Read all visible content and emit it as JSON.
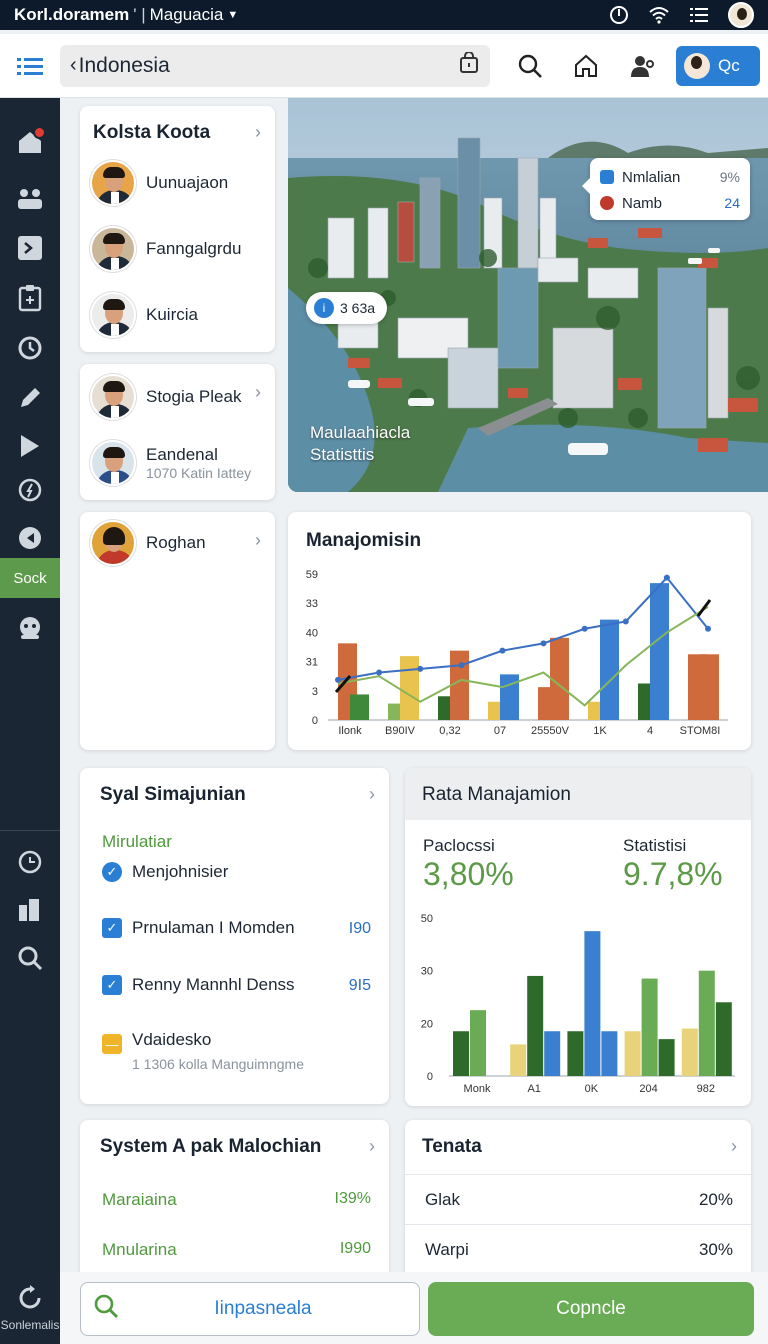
{
  "status": {
    "app_name": "Korl.doramem",
    "separator": "' |",
    "location": "Maguacia"
  },
  "toolbar": {
    "search_value": "Indonesia",
    "profile_label": "Qc"
  },
  "sidebar": {
    "active_label": "Sock",
    "bottom_label": "Sonlemalis"
  },
  "people_card": {
    "title": "Kolsta Koota",
    "people": [
      {
        "name": "Uunuajaon"
      },
      {
        "name": "Fanngalgrdu"
      },
      {
        "name": "Kuircia"
      }
    ]
  },
  "people_card2": {
    "people": [
      {
        "name": "Stogia Pleak"
      },
      {
        "name": "Eandenal",
        "sub": "1070 Katin Iattey"
      }
    ]
  },
  "people_card3": {
    "people": [
      {
        "name": "Roghan"
      }
    ]
  },
  "photo": {
    "caption_line1": "Maulaahiacla",
    "caption_line2": "Statisttis",
    "pill_icon": "i",
    "pill_text": "3 63a",
    "legend": [
      {
        "label": "Nmlalian",
        "value": "9%",
        "color": "#2a7fd4"
      },
      {
        "label": "Namb",
        "value": "24",
        "color": "#c0392b"
      }
    ]
  },
  "chart1": {
    "title": "Manajomisin"
  },
  "chart2": {
    "title": "Rata Manajamion",
    "stat1_label": "Paclocssi",
    "stat1_value": "3,80%",
    "stat2_label": "Statistisi",
    "stat2_value": "9.7,8%"
  },
  "chart_data": [
    {
      "type": "bar",
      "categories": [
        "Ilonk",
        "B90IV",
        "0,32",
        "07",
        "25550V",
        "1K",
        "4",
        "STOM8I"
      ],
      "y_ticks": [
        "0",
        "3",
        "31",
        "40",
        "33",
        "59"
      ],
      "series": [
        {
          "values": [
            28,
            12,
            16,
            10,
            18,
            6,
            14,
            14,
            16,
            16
          ]
        },
        {
          "values": [
            42,
            0,
            26,
            36,
            36,
            38,
            32,
            58,
            0,
            0
          ]
        }
      ],
      "bars": [
        {
          "x": 0,
          "value": 42,
          "color": "#cf6a3c"
        },
        {
          "x": 0.12,
          "value": 14,
          "color": "#3f8a3a"
        },
        {
          "x": 1,
          "value": 9,
          "color": "#86b55a"
        },
        {
          "x": 1.12,
          "value": 35,
          "color": "#e8c34d"
        },
        {
          "x": 2,
          "value": 13,
          "color": "#2e6b2b"
        },
        {
          "x": 2.12,
          "value": 38,
          "color": "#cf6a3c"
        },
        {
          "x": 3,
          "value": 10,
          "color": "#e8c34d"
        },
        {
          "x": 3.12,
          "value": 25,
          "color": "#3b7fd0"
        },
        {
          "x": 4,
          "value": 18,
          "color": "#cf6a3c"
        },
        {
          "x": 4.12,
          "value": 45,
          "color": "#cf6a3c"
        },
        {
          "x": 5,
          "value": 10,
          "color": "#e8c34d"
        },
        {
          "x": 5.12,
          "value": 55,
          "color": "#3b7fd0"
        },
        {
          "x": 6,
          "value": 20,
          "color": "#2e6b2b"
        },
        {
          "x": 6.12,
          "value": 75,
          "color": "#3b7fd0"
        },
        {
          "x": 7,
          "value": 36,
          "color": "#cf6a3c"
        },
        {
          "x": 7.12,
          "value": 36,
          "color": "#cf6a3c"
        }
      ],
      "line_blue": [
        22,
        26,
        28,
        30,
        38,
        42,
        50,
        54,
        78,
        50
      ],
      "line_green": [
        20,
        24,
        10,
        22,
        18,
        26,
        8,
        30,
        48,
        62
      ]
    },
    {
      "type": "bar",
      "categories": [
        "Monk",
        "A1",
        "0K",
        "204",
        "982"
      ],
      "y_ticks": [
        "0",
        "20",
        "30",
        "50"
      ],
      "ylim": [
        0,
        60
      ],
      "groups": [
        {
          "values": [
            17,
            25,
            0,
            38
          ],
          "colors": [
            "#2e6b2b",
            "#6aab55",
            "#3b7fd0",
            "#3b7fd0"
          ]
        },
        {
          "values": [
            12,
            38,
            17,
            0
          ],
          "colors": [
            "#e8d27a",
            "#2e6b2b",
            "#3b7fd0",
            "#3b7fd0"
          ]
        },
        {
          "values": [
            17,
            55,
            17,
            0
          ],
          "colors": [
            "#2e6b2b",
            "#3b7fd0",
            "#3b7fd0",
            "#3b7fd0"
          ]
        },
        {
          "values": [
            17,
            37,
            14,
            0
          ],
          "colors": [
            "#e8d27a",
            "#6aab55",
            "#2e6b2b",
            "#2e6b2b"
          ]
        },
        {
          "values": [
            18,
            40,
            28,
            0
          ],
          "colors": [
            "#e8d27a",
            "#6aab55",
            "#2e6b2b",
            "#2e6b2b"
          ]
        }
      ]
    }
  ],
  "checklist_card": {
    "title": "Syal Simajunian",
    "section": "Mirulatiar",
    "items": [
      {
        "label": "Menjohnisier",
        "value": ""
      },
      {
        "label": "Prnulaman I Momden",
        "value": "I90"
      },
      {
        "label": "Renny Mannhl Denss",
        "value": "9I5"
      },
      {
        "label": "Vdaidesko",
        "value": "",
        "sub": "1 1306 kolla Manguimngme"
      }
    ]
  },
  "system_card": {
    "title": "System A pak Malochian",
    "rows": [
      {
        "label": "Maraiaina",
        "value": "I39%"
      },
      {
        "label": "Mnularina",
        "value": "I990"
      }
    ]
  },
  "tenata_card": {
    "title": "Tenata",
    "rows": [
      {
        "label": "Glak",
        "value": "20%"
      },
      {
        "label": "Warpi",
        "value": "30%"
      }
    ]
  },
  "bottom": {
    "search_placeholder": "Iinpasneala",
    "button_label": "Copncle"
  }
}
